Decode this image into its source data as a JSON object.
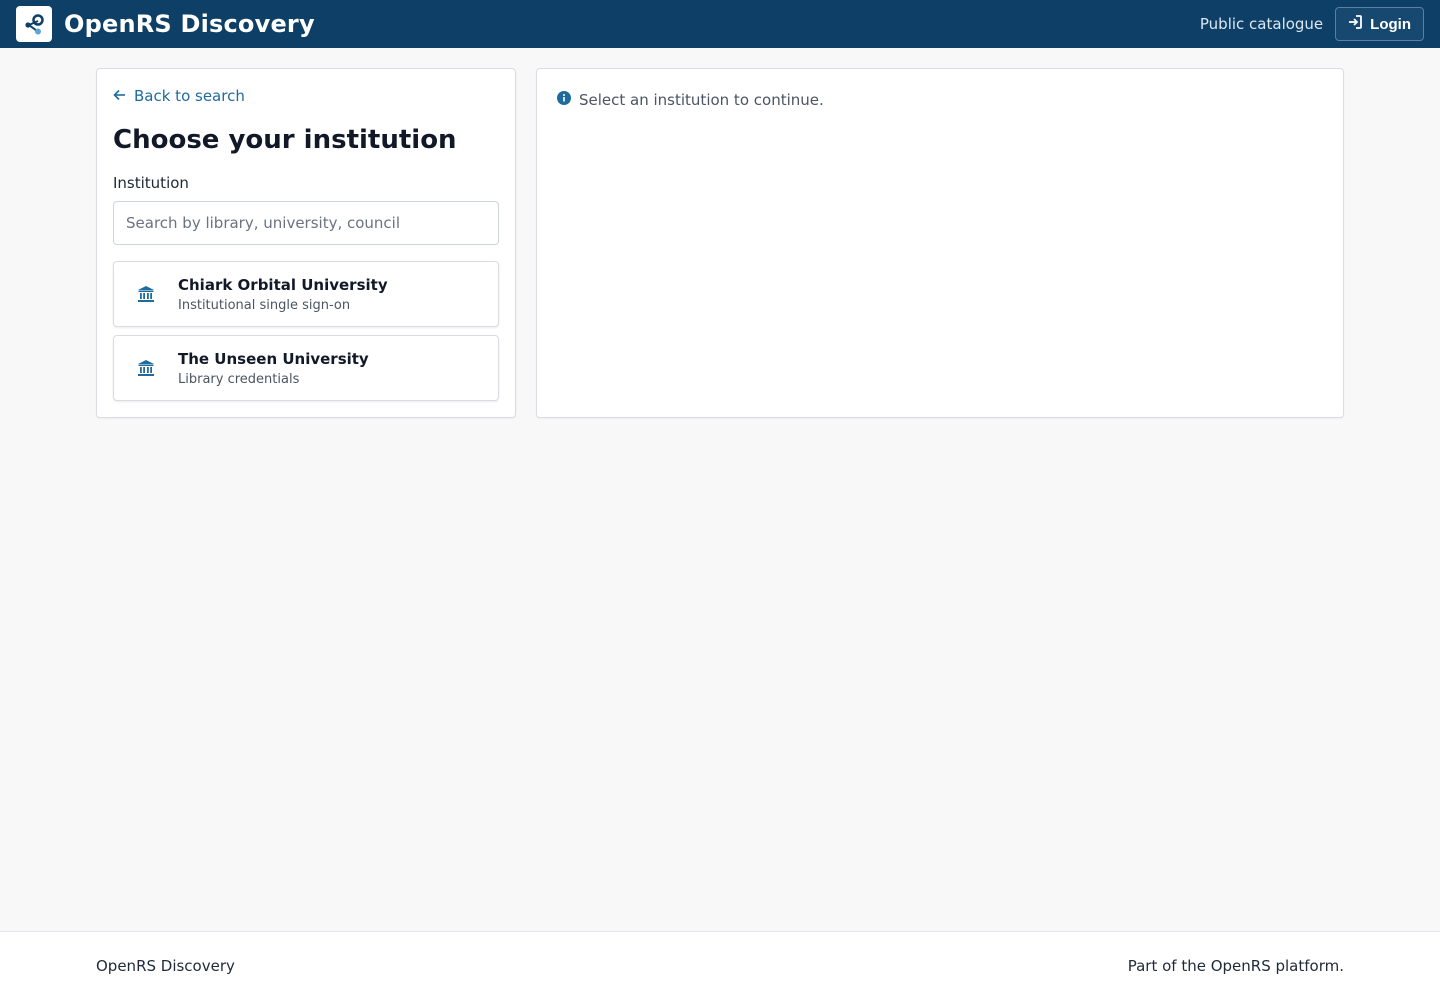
{
  "header": {
    "app_title": "OpenRS Discovery",
    "public_catalogue_label": "Public catalogue",
    "login_label": "Login",
    "brand_color": "#0e3f66"
  },
  "left_panel": {
    "back_label": "Back to search",
    "heading": "Choose your institution",
    "field_label": "Institution",
    "search_placeholder": "Search by library, university, council",
    "search_value": "",
    "institutions": [
      {
        "name": "Chiark Orbital University",
        "method": "Institutional single sign-on",
        "icon": "institution-icon"
      },
      {
        "name": "The Unseen University",
        "method": "Library credentials",
        "icon": "institution-icon"
      }
    ]
  },
  "right_panel": {
    "info_text": "Select an institution to continue.",
    "info_icon": "info-icon"
  },
  "footer": {
    "left_text": "OpenRS Discovery",
    "right_text": "Part of the OpenRS platform."
  }
}
